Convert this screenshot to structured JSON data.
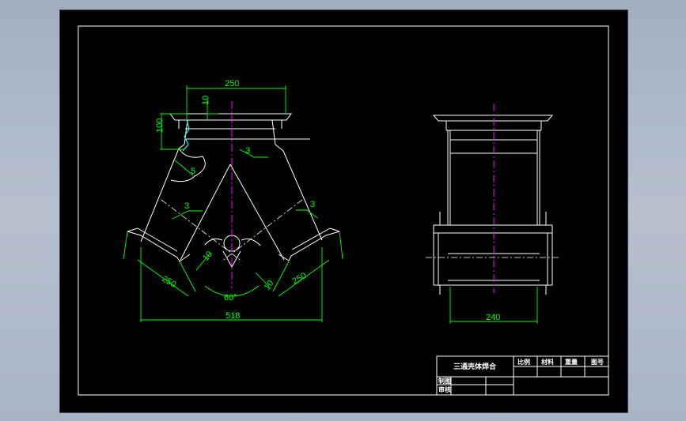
{
  "colors": {
    "background_outer": "#b0bac9",
    "canvas": "#000000",
    "outline": "#ffffff",
    "dimension": "#00ff00",
    "centerline": "#ff00ff",
    "weld_detail": "#00ffff"
  },
  "front_view": {
    "dims": {
      "top_width": "250",
      "flange_thickness": "10",
      "height": "100",
      "weld_1": "3",
      "weld_2": "3",
      "weld_3": "3",
      "chamfer": "5",
      "left_branch_length": "250",
      "right_branch_length": "250",
      "left_branch_thk": "10",
      "right_branch_thk": "10",
      "angle": "60°",
      "overall_width": "518"
    }
  },
  "side_view": {
    "dims": {
      "width": "240"
    }
  },
  "title_block": {
    "title": "三通壳体焊合",
    "headers": [
      "比例",
      "材料",
      "重量",
      "图号"
    ],
    "row_labels": [
      "制图",
      "审核"
    ]
  }
}
